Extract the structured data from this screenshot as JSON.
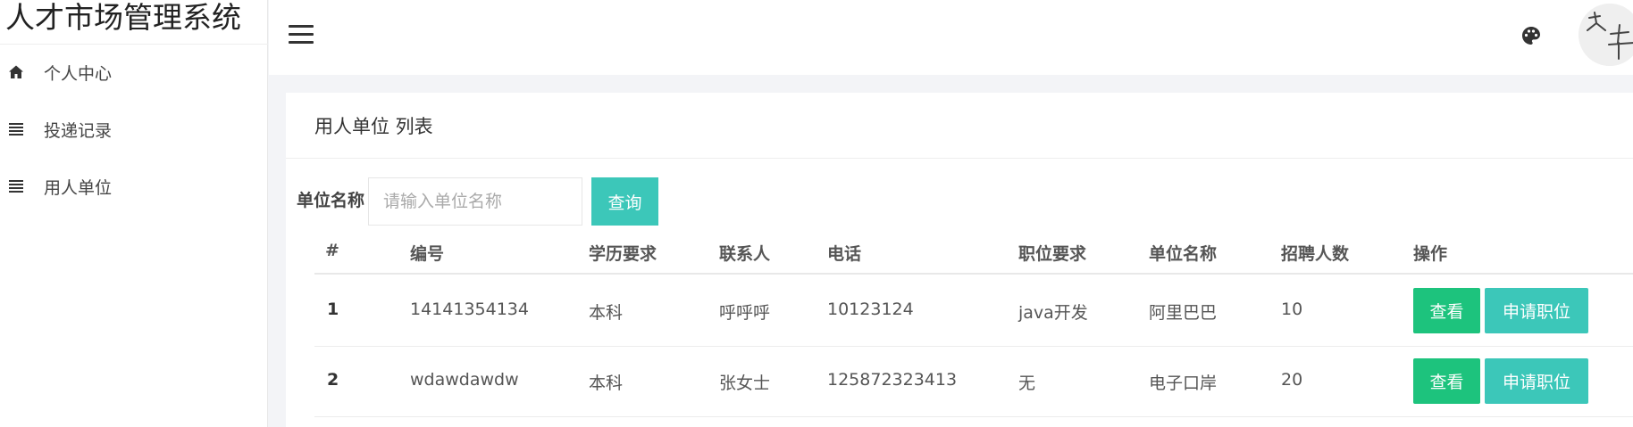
{
  "app": {
    "title": "人才市场管理系统"
  },
  "sidebar": {
    "items": [
      {
        "label": "个人中心",
        "icon": "home-icon"
      },
      {
        "label": "投递记录",
        "icon": "list-icon"
      },
      {
        "label": "用人单位",
        "icon": "list-icon"
      }
    ]
  },
  "topbar": {
    "menu_icon": "hamburger-icon",
    "theme_icon": "palette-icon",
    "avatar_icon": "avatar-icon"
  },
  "card": {
    "title": "用人单位 列表"
  },
  "filter": {
    "label": "单位名称",
    "placeholder": "请输入单位名称",
    "value": "",
    "query_label": "查询"
  },
  "table": {
    "columns": [
      "#",
      "编号",
      "学历要求",
      "联系人",
      "电话",
      "职位要求",
      "单位名称",
      "招聘人数",
      "操作"
    ],
    "rows": [
      {
        "index": "1",
        "code": "14141354134",
        "education": "本科",
        "contact": "呼呼呼",
        "phone": "10123124",
        "position": "java开发",
        "company": "阿里巴巴",
        "count": "10",
        "view": "查看",
        "apply": "申请职位"
      },
      {
        "index": "2",
        "code": "wdawdawdw",
        "education": "本科",
        "contact": "张女士",
        "phone": "125872323413",
        "position": "无",
        "company": "电子口岸",
        "count": "20",
        "view": "查看",
        "apply": "申请职位"
      }
    ]
  },
  "colors": {
    "teal": "#3cc7b9",
    "green": "#1dc37d",
    "background": "#f3f4f7"
  }
}
